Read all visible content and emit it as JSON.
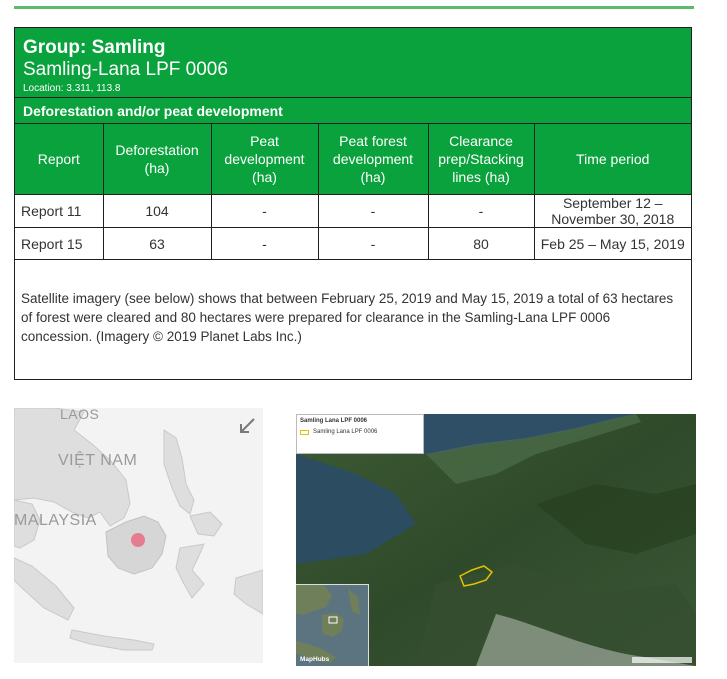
{
  "group": {
    "title": "Group: Samling",
    "concession": "Samling-Lana LPF 0006",
    "location": "Location: 3.311, 113.8"
  },
  "section": {
    "title": "Deforestation and/or peat development"
  },
  "table": {
    "headers": [
      "Report",
      "Deforestation (ha)",
      "Peat development (ha)",
      "Peat forest development (ha)",
      "Clearance prep/Stacking lines (ha)",
      "Time period"
    ],
    "rows": [
      [
        "Report 11",
        "104",
        "-",
        "-",
        "-",
        "September 12 – November 30, 2018"
      ],
      [
        "Report 15",
        "63",
        "-",
        "-",
        "80",
        "Feb 25 – May 15, 2019"
      ]
    ]
  },
  "note": "Satellite imagery (see below) shows that between February 25, 2019 and May 15, 2019 a total of 63 hectares of forest were cleared and 80 hectares were prepared for clearance in the Samling-Lana LPF 0006 concession. (Imagery © 2019 Planet Labs Inc.)",
  "locator_map": {
    "labels": {
      "top": "LAOS",
      "country1": "VIỆT NAM",
      "country2": "MALAYSIA"
    },
    "marker_color": "#e67c90",
    "expand_icon": "expand-arrow-icon"
  },
  "satellite_map": {
    "legend_title": "Samling Lana LPF 0006",
    "legend_item": "Samling Lana LPF 0006",
    "attribution": "MapHubs",
    "outline_color": "#e3c200"
  }
}
